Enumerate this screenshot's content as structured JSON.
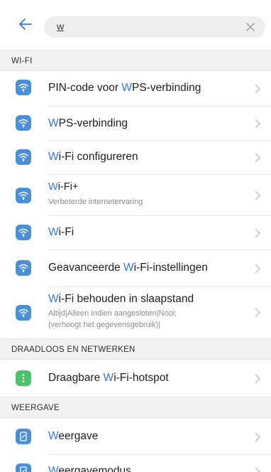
{
  "search": {
    "query": "w"
  },
  "sections": {
    "wifi": "WI-FI",
    "wireless": "DRAADLOOS EN NETWERKEN",
    "display": "WEERGAVE"
  },
  "rows": [
    {
      "pre": "PIN-code voor ",
      "hl": "W",
      "post": "PS-verbinding"
    },
    {
      "pre": "",
      "hl": "W",
      "post": "PS-verbinding"
    },
    {
      "pre": "",
      "hl": "W",
      "post": "i-Fi configureren"
    },
    {
      "pre": "",
      "hl": "W",
      "post": "i-Fi+",
      "sub": "Verbeterde internetervaring"
    },
    {
      "pre": "",
      "hl": "W",
      "post": "i-Fi"
    },
    {
      "pre": "Geavanceerde ",
      "hl": "W",
      "post": "i-Fi-instellingen"
    },
    {
      "pre": "",
      "hl": "W",
      "post": "i-Fi behouden in slaapstand",
      "sub": "Altijd|Alleen indien aangesloten|Nooi;",
      "sub2": "(verhoogt het gegevensgebruik)|"
    },
    {
      "pre": "Draagbare ",
      "hl": "W",
      "post": "i-Fi-hotspot"
    },
    {
      "pre": "",
      "hl": "W",
      "post": "eergave"
    },
    {
      "pre": "",
      "hl": "W",
      "post": "eergavemodus"
    }
  ],
  "colors": {
    "accent": "#3478e5",
    "wifi_icon": "#4a90d9",
    "hotspot_icon": "#4cc36a"
  },
  "icons": {
    "back": "arrow-left-icon",
    "clear": "close-icon",
    "wifi": "wifi-icon",
    "hotspot": "more-vertical-icon",
    "display": "display-icon",
    "chevron": "chevron-right-icon"
  }
}
